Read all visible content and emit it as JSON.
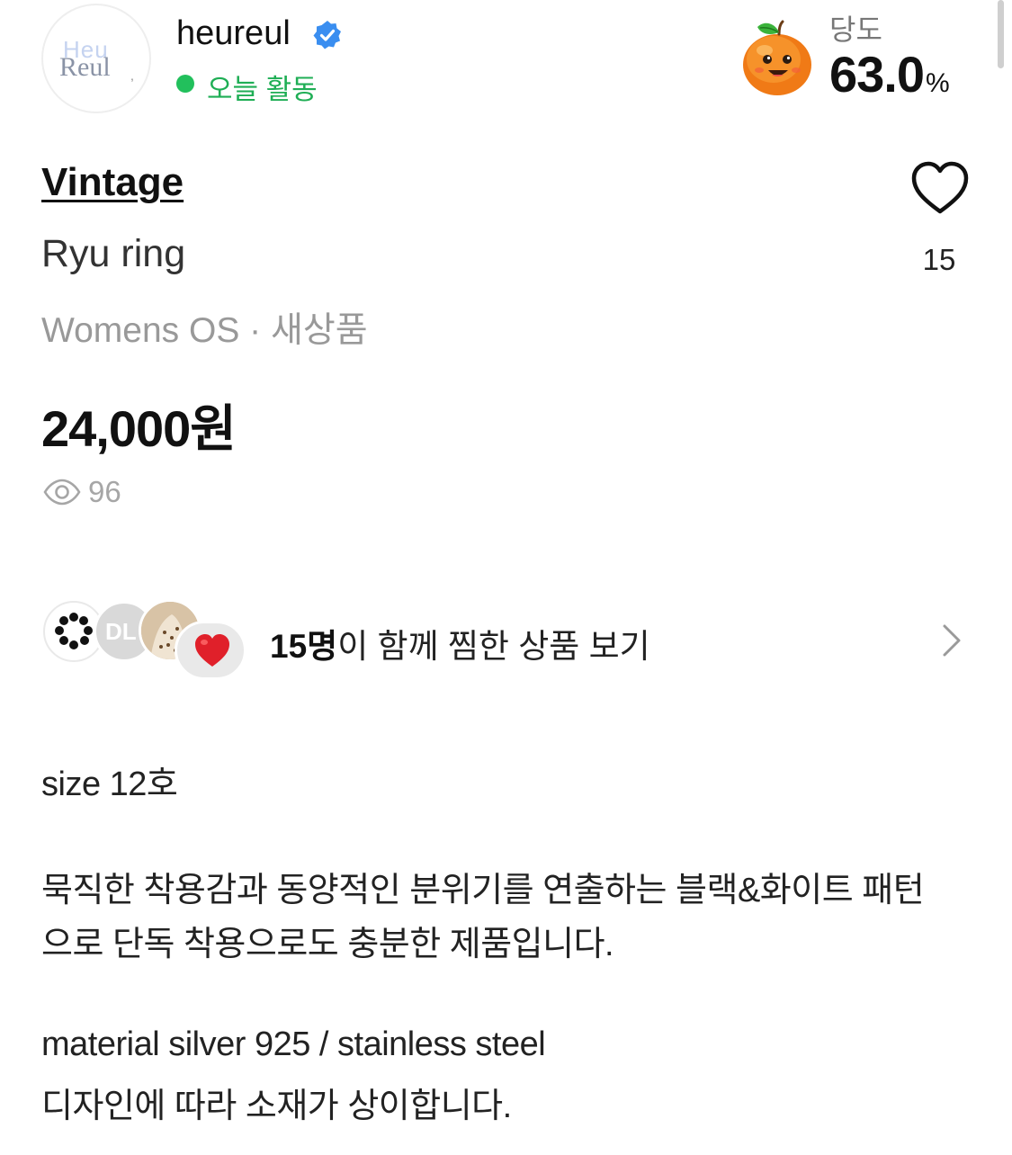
{
  "seller": {
    "avatar_logo_top": "Heu",
    "avatar_logo_bottom": "Reul",
    "avatar_logo_mark": ",",
    "name": "heureul",
    "verified_icon": "verified-badge-icon",
    "status": "오늘 활동",
    "status_color": "#22c05c"
  },
  "sweetness": {
    "label": "당도",
    "value": "63.0",
    "unit": "%",
    "icon": "peach-character-icon"
  },
  "product": {
    "brand": "Vintage",
    "title": "Ryu ring",
    "meta": "Womens OS · 새상품",
    "price": "24,000원",
    "views": "96",
    "likes": "15"
  },
  "together": {
    "avatar2_text": "DL",
    "count": "15명",
    "text": "이 함께 찜한 상품 보기"
  },
  "description": {
    "line1": "size 12호",
    "line2": "묵직한 착용감과 동양적인 분위기를 연출하는 블랙&화이트 패턴",
    "line3": "으로 단독 착용으로도 충분한 제품입니다.",
    "line4": "material silver 925 / stainless steel",
    "line5": "디자인에 따라 소재가 상이합니다."
  }
}
